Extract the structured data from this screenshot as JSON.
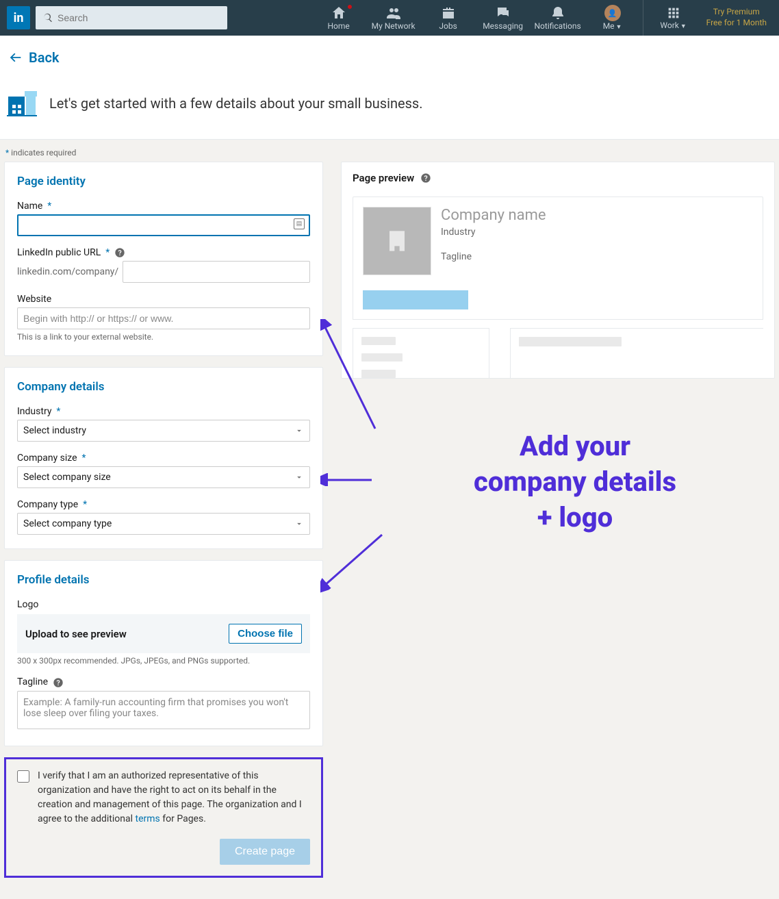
{
  "nav": {
    "search_placeholder": "Search",
    "items": {
      "home": "Home",
      "network": "My Network",
      "jobs": "Jobs",
      "messaging": "Messaging",
      "notifications": "Notifications",
      "me": "Me",
      "work": "Work"
    },
    "premium_line1": "Try Premium",
    "premium_line2": "Free for 1 Month"
  },
  "back_label": "Back",
  "intro_text": "Let's get started with a few details about your small business.",
  "required_note": "indicates required",
  "identity": {
    "heading": "Page identity",
    "name_label": "Name",
    "url_label": "LinkedIn public URL",
    "url_prefix": "linkedin.com/company/",
    "website_label": "Website",
    "website_placeholder": "Begin with http:// or https:// or www.",
    "website_hint": "This is a link to your external website."
  },
  "company": {
    "heading": "Company details",
    "industry_label": "Industry",
    "industry_select": "Select industry",
    "size_label": "Company size",
    "size_select": "Select company size",
    "type_label": "Company type",
    "type_select": "Select company type"
  },
  "profile": {
    "heading": "Profile details",
    "logo_label": "Logo",
    "upload_label": "Upload to see preview",
    "choose_file": "Choose file",
    "logo_hint": "300 x 300px recommended. JPGs, JPEGs, and PNGs supported.",
    "tagline_label": "Tagline",
    "tagline_placeholder": "Example: A family-run accounting firm that promises you won't lose sleep over filing your taxes."
  },
  "verify": {
    "text_before": "I verify that I am an authorized representative of this organization and have the right to act on its behalf in the creation and management of this page. The organization and I agree to the additional ",
    "link": "terms",
    "text_after": " for Pages.",
    "create_button": "Create page"
  },
  "preview": {
    "heading": "Page preview",
    "company_name": "Company name",
    "industry": "Industry",
    "tagline": "Tagline"
  },
  "annotation": {
    "line1": "Add your",
    "line2": "company details",
    "line3": "+ logo"
  },
  "asterisk": "*"
}
